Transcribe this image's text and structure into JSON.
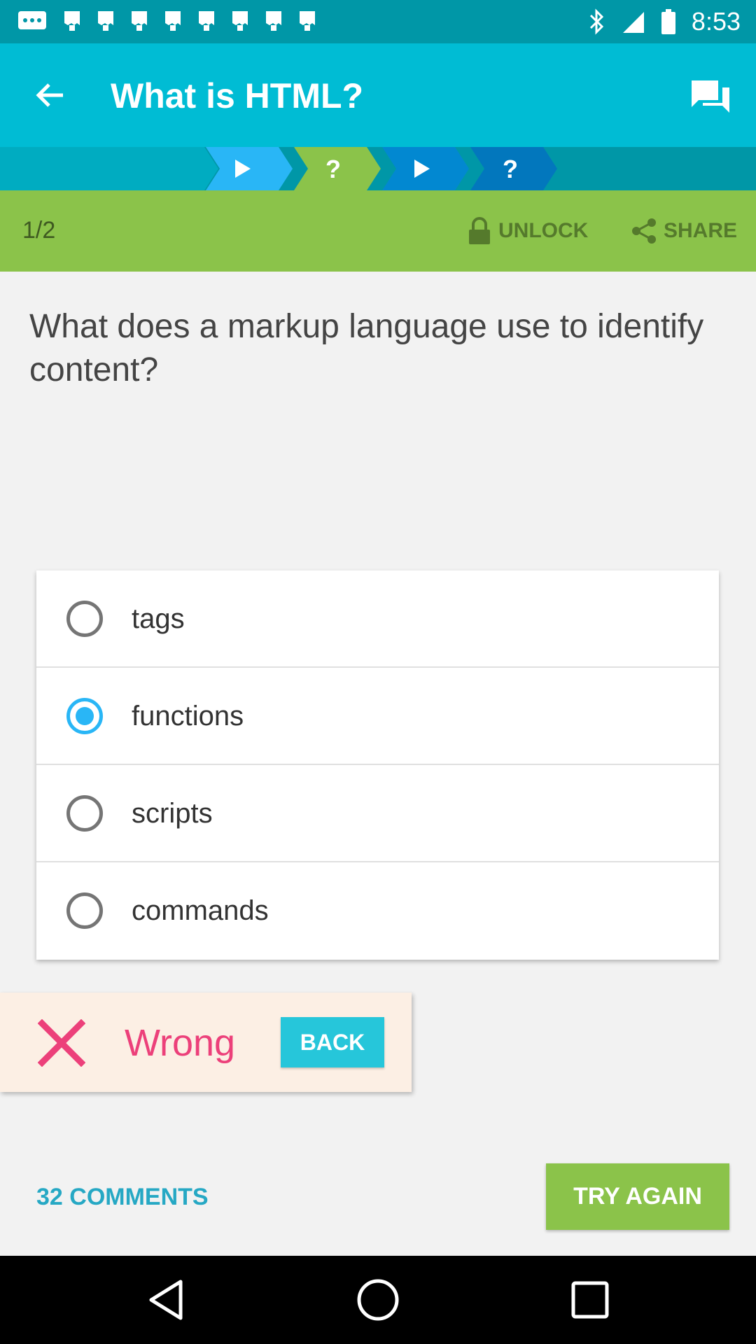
{
  "status_bar": {
    "time": "8:53",
    "notification_icons": [
      "message-icon",
      "image-icon",
      "image-icon",
      "image-icon",
      "image-icon",
      "image-icon",
      "image-icon",
      "image-icon",
      "image-icon"
    ],
    "status_icons": [
      "bluetooth-icon",
      "signal-icon",
      "battery-icon"
    ]
  },
  "app_bar": {
    "title": "What is HTML?",
    "back_icon": "arrow-left-icon",
    "chat_icon": "forum-icon"
  },
  "progress": {
    "steps": [
      {
        "icon": "play-icon",
        "type": "lesson",
        "state": "done"
      },
      {
        "icon": "question-icon",
        "type": "quiz",
        "state": "current"
      },
      {
        "icon": "play-icon",
        "type": "lesson",
        "state": "upcoming"
      },
      {
        "icon": "question-icon",
        "type": "quiz",
        "state": "upcoming"
      }
    ]
  },
  "lesson_bar": {
    "page": "1/2",
    "unlock_label": "UNLOCK",
    "share_label": "SHARE"
  },
  "question": {
    "text": "What does a markup language use to identify content?",
    "options": [
      {
        "label": "tags",
        "selected": false
      },
      {
        "label": "functions",
        "selected": true
      },
      {
        "label": "scripts",
        "selected": false
      },
      {
        "label": "commands",
        "selected": false
      }
    ]
  },
  "feedback": {
    "status": "Wrong",
    "back_label": "BACK"
  },
  "footer": {
    "comments_label": "32 COMMENTS",
    "try_again_label": "TRY AGAIN"
  },
  "colors": {
    "accent": "#00bcd4",
    "accent_dark": "#0097a7",
    "green": "#8bc34a",
    "radio_selected": "#29b6f6",
    "wrong": "#ec407a"
  }
}
